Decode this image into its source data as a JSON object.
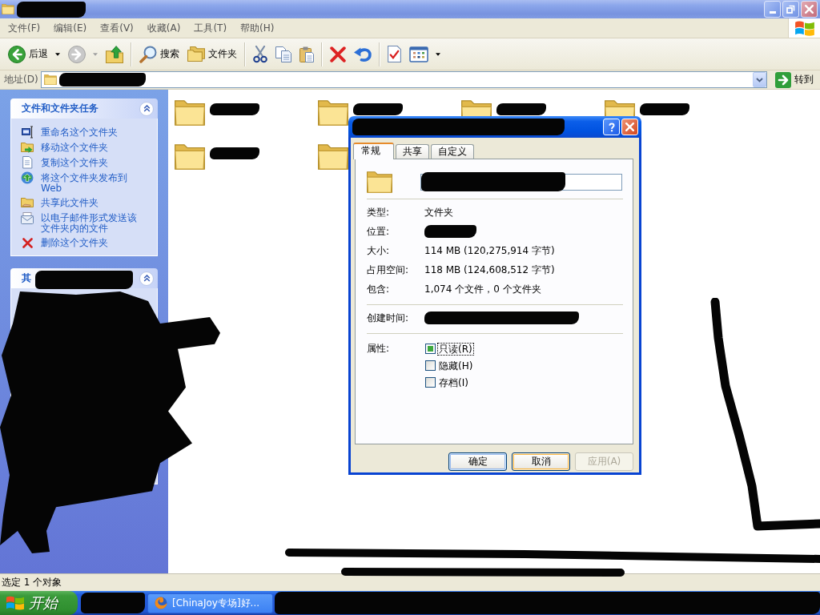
{
  "window": {
    "active": false,
    "title_redacted": true,
    "controls": [
      {
        "kind": "minimize"
      },
      {
        "kind": "restore"
      },
      {
        "kind": "close"
      }
    ]
  },
  "menu": [
    {
      "label": "文件(F)"
    },
    {
      "label": "编辑(E)"
    },
    {
      "label": "查看(V)"
    },
    {
      "label": "收藏(A)"
    },
    {
      "label": "工具(T)"
    },
    {
      "label": "帮助(H)"
    }
  ],
  "toolbar": [
    {
      "kind": "back",
      "label": "后退",
      "dropdown": true,
      "disabled": false
    },
    {
      "kind": "forward",
      "dropdown": true,
      "disabled": true
    },
    {
      "kind": "up",
      "dropdown": false,
      "disabled": false
    },
    {
      "kind": "separator"
    },
    {
      "kind": "search",
      "label": "搜索",
      "dropdown": false,
      "disabled": false
    },
    {
      "kind": "folders",
      "label": "文件夹",
      "dropdown": false,
      "disabled": false
    },
    {
      "kind": "separator"
    },
    {
      "kind": "cut",
      "dropdown": false,
      "disabled": false
    },
    {
      "kind": "copy",
      "dropdown": false,
      "disabled": false
    },
    {
      "kind": "paste",
      "dropdown": false,
      "disabled": false
    },
    {
      "kind": "separator"
    },
    {
      "kind": "delete",
      "dropdown": false,
      "disabled": false
    },
    {
      "kind": "undo",
      "dropdown": false,
      "disabled": false
    },
    {
      "kind": "separator"
    },
    {
      "kind": "properties",
      "dropdown": false,
      "disabled": false
    },
    {
      "kind": "views",
      "dropdown": true,
      "disabled": false
    }
  ],
  "address_bar": {
    "label": "地址(D)",
    "redacted": true,
    "go_label": "转到"
  },
  "task_pane": {
    "panels": [
      {
        "title": "文件和文件夹任务",
        "expanded": true,
        "items": [
          {
            "kind": "rename",
            "label": "重命名这个文件夹"
          },
          {
            "kind": "move",
            "label": "移动这个文件夹"
          },
          {
            "kind": "copy",
            "label": "复制这个文件夹"
          },
          {
            "kind": "publish",
            "label": "将这个文件夹发布到 Web"
          },
          {
            "kind": "share",
            "label": "共享此文件夹"
          },
          {
            "kind": "email",
            "label": "以电子邮件形式发送该文件夹内的文件"
          },
          {
            "kind": "delete",
            "label": "删除这个文件夹"
          }
        ]
      },
      {
        "title": "其",
        "expanded": true
      }
    ]
  },
  "folders": [
    {
      "kind": "folder",
      "redacted": true
    },
    {
      "kind": "folder",
      "redacted": true
    },
    {
      "kind": "folder",
      "redacted": true
    },
    {
      "kind": "folder",
      "redacted": true
    },
    {
      "kind": "folder",
      "redacted": true
    },
    {
      "kind": "folder",
      "redacted": false
    }
  ],
  "dialog": {
    "active": true,
    "title_redacted": true,
    "controls": [
      {
        "kind": "help"
      },
      {
        "kind": "close"
      }
    ],
    "tabs": [
      {
        "label": "常规",
        "selected": true
      },
      {
        "label": "共享",
        "selected": false
      },
      {
        "label": "自定义",
        "selected": false
      }
    ],
    "name_field": {
      "redacted": true
    },
    "sections": [
      {
        "rows": [
          {
            "label": "类型:",
            "value": "文件夹",
            "redacted": false
          },
          {
            "label": "位置:",
            "redacted": true
          },
          {
            "label": "大小:",
            "value": "114 MB (120,275,914 字节)",
            "redacted": false
          },
          {
            "label": "占用空间:",
            "value": "118 MB (124,608,512 字节)",
            "redacted": false
          },
          {
            "label": "包含:",
            "value": "1,074 个文件，0 个文件夹",
            "redacted": false
          }
        ]
      },
      {
        "rows": [
          {
            "label": "创建时间:",
            "redacted": true
          }
        ]
      }
    ],
    "attributes": {
      "label": "属性:",
      "options": [
        {
          "label": "只读(R)",
          "checked": false,
          "mixed": true,
          "focused": true
        },
        {
          "label": "隐藏(H)",
          "checked": false,
          "mixed": false,
          "focused": false
        },
        {
          "label": "存档(I)",
          "checked": false,
          "mixed": false,
          "focused": false
        }
      ]
    },
    "buttons": [
      {
        "label": "确定",
        "default": true,
        "hovered": false,
        "disabled": false
      },
      {
        "label": "取消",
        "default": false,
        "hovered": true,
        "disabled": false
      },
      {
        "label": "应用(A)",
        "default": false,
        "hovered": false,
        "disabled": true
      }
    ]
  },
  "status_bar": {
    "text": "选定 1 个对象"
  },
  "taskbar": {
    "start_label": "开始",
    "quick_launch_redacted": true,
    "tasks": [
      {
        "kind": "browser",
        "label": "[ChinaJoy专场]好..."
      }
    ],
    "tray_redacted": true
  }
}
